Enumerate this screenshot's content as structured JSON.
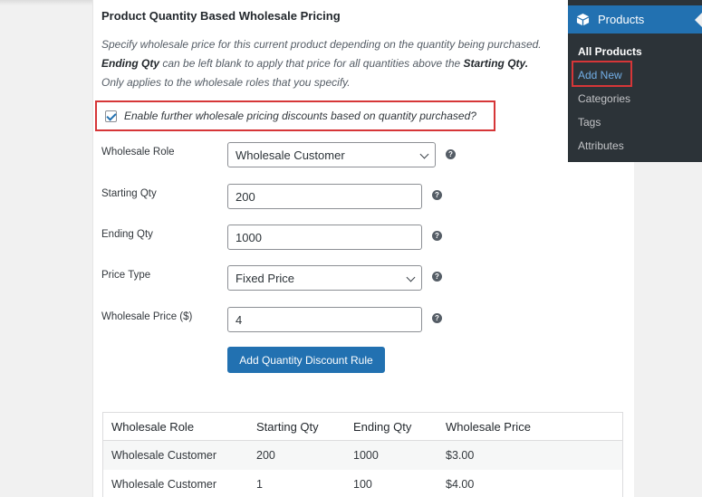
{
  "section": {
    "title": "Product Quantity Based Wholesale Pricing",
    "desc_line1": "Specify wholesale price for this current product depending on the quantity being purchased.",
    "desc_line2_b1": "Ending Qty",
    "desc_line2_mid": " can be left blank to apply that price for all quantities above the ",
    "desc_line2_b2": "Starting Qty.",
    "desc_line3": "Only applies to the wholesale roles that you specify."
  },
  "enable_checkbox": {
    "label": "Enable further wholesale pricing discounts based on quantity purchased?",
    "checked": true
  },
  "form": {
    "wholesale_role_label": "Wholesale Role",
    "wholesale_role_value": "Wholesale Customer",
    "starting_qty_label": "Starting Qty",
    "starting_qty_value": "200",
    "ending_qty_label": "Ending Qty",
    "ending_qty_value": "1000",
    "price_type_label": "Price Type",
    "price_type_value": "Fixed Price",
    "wholesale_price_label": "Wholesale Price ($)",
    "wholesale_price_value": "4",
    "help_glyph": "?",
    "add_button": "Add Quantity Discount Rule"
  },
  "table": {
    "headers": [
      "Wholesale Role",
      "Starting Qty",
      "Ending Qty",
      "Wholesale Price"
    ],
    "rows": [
      [
        "Wholesale Customer",
        "200",
        "1000",
        "$3.00"
      ],
      [
        "Wholesale Customer",
        "1",
        "100",
        "$4.00"
      ]
    ]
  },
  "admin_menu": {
    "title": "Products",
    "items": [
      "All Products",
      "Add New",
      "Categories",
      "Tags",
      "Attributes"
    ]
  },
  "colors": {
    "accent": "#2271b1",
    "highlight_border": "#d63638",
    "menu_bg": "#2c3338"
  }
}
